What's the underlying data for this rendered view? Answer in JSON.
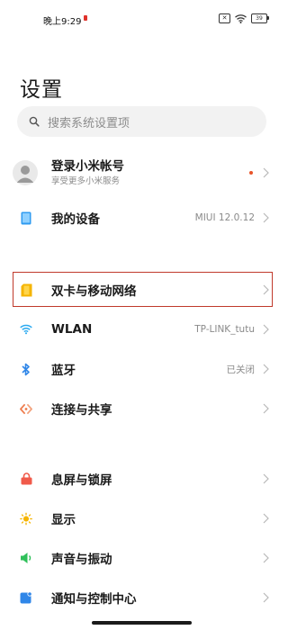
{
  "status_bar": {
    "time": "晚上9:29",
    "x_icon": "x-box-icon",
    "battery": "39"
  },
  "page_title": "设置",
  "search": {
    "placeholder": "搜索系统设置项"
  },
  "account": {
    "label": "登录小米帐号",
    "sublabel": "享受更多小米服务",
    "badge_color": "#e8542a"
  },
  "my_device": {
    "label": "我的设备",
    "value": "MIUI 12.0.12",
    "icon": "device-icon",
    "color": "#2f9bf0"
  },
  "network_items": [
    {
      "label": "双卡与移动网络",
      "value": "",
      "icon": "sim-card-icon",
      "color": "#f5b400"
    },
    {
      "label": "WLAN",
      "value": "TP-LINK_tutu",
      "icon": "wifi-icon",
      "color": "#2aa9f0"
    },
    {
      "label": "蓝牙",
      "value": "已关闭",
      "icon": "bluetooth-icon",
      "color": "#2f86e8"
    },
    {
      "label": "连接与共享",
      "value": "",
      "icon": "share-icon",
      "color": "#ee7a4a"
    }
  ],
  "display_items": [
    {
      "label": "息屏与锁屏",
      "icon": "lock-icon",
      "color": "#f05a4a"
    },
    {
      "label": "显示",
      "icon": "sun-icon",
      "color": "#f5b400"
    },
    {
      "label": "声音与振动",
      "icon": "speaker-icon",
      "color": "#2fc05a"
    },
    {
      "label": "通知与控制中心",
      "icon": "notification-icon",
      "color": "#2f86e8"
    }
  ]
}
